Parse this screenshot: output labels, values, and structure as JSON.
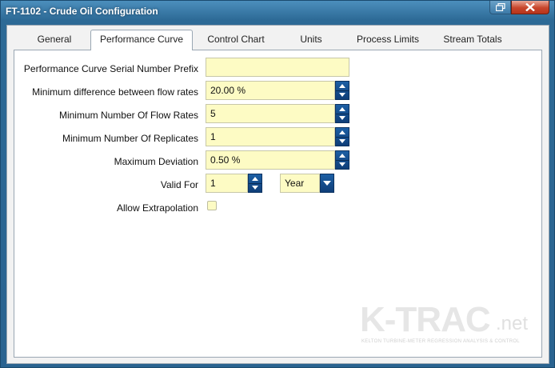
{
  "window": {
    "title": "FT-1102 - Crude Oil Configuration"
  },
  "tabs": [
    {
      "label": "General",
      "active": false
    },
    {
      "label": "Performance Curve",
      "active": true
    },
    {
      "label": "Control Chart",
      "active": false
    },
    {
      "label": "Units",
      "active": false
    },
    {
      "label": "Process Limits",
      "active": false
    },
    {
      "label": "Stream Totals",
      "active": false
    }
  ],
  "form": {
    "serial_prefix": {
      "label": "Performance Curve Serial Number Prefix",
      "value": ""
    },
    "min_difference": {
      "label": "Minimum difference between flow rates",
      "value": "20.00 %"
    },
    "min_flow_rates": {
      "label": "Minimum Number Of Flow Rates",
      "value": "5"
    },
    "min_replicates": {
      "label": "Minimum Number Of Replicates",
      "value": "1"
    },
    "max_deviation": {
      "label": "Maximum Deviation",
      "value": "0.50 %"
    },
    "valid_for": {
      "label": "Valid For",
      "value": "1",
      "unit": "Year"
    },
    "allow_extrapolation": {
      "label": "Allow Extrapolation",
      "checked": false
    }
  },
  "logo": {
    "main": "K-TRAC",
    "suffix": ".net",
    "tagline": "KELTON TURBINE-METER REGRESSION ANALYSIS & CONTROL"
  },
  "colors": {
    "field_bg": "#fdfbc4",
    "spinner": "#1c5fa4",
    "frame": "#2d6a96",
    "close": "#c7452b"
  }
}
